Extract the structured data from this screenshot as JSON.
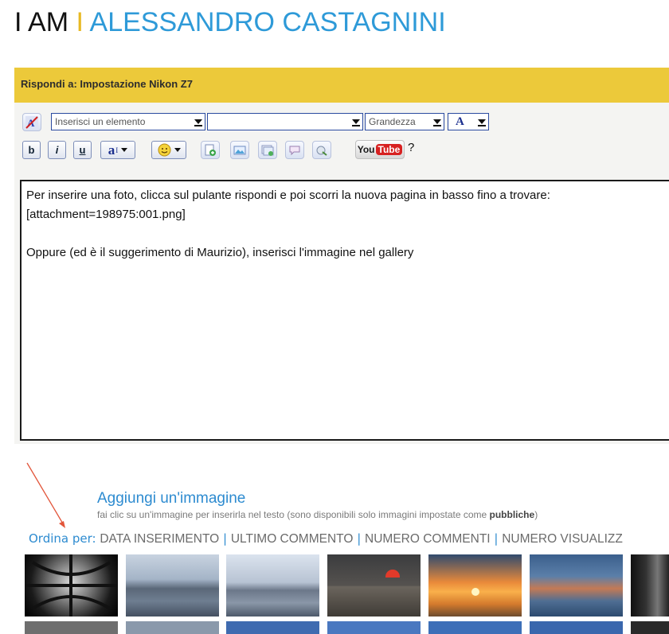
{
  "header": {
    "title_left": "I AM",
    "title_sep": "I",
    "title_right": "ALESSANDRO CASTAGNINI"
  },
  "reply": {
    "label": "Rispondi a: Impostazione Nikon Z7"
  },
  "toolbar": {
    "insert_element": "Inserisci un elemento",
    "second_select": "",
    "size_select": "Grandezza",
    "font_color_label": "A",
    "bold": "b",
    "italic": "i",
    "underline": "u",
    "font_style": "a",
    "youtube_you": "You",
    "youtube_tube": "Tube",
    "help": "?"
  },
  "editor": {
    "line1": "Per inserire una foto, clicca sul pulante rispondi e poi scorri la nuova pagina in basso fino a trovare:",
    "line2": "[attachment=198975:001.png]",
    "line3": "",
    "line4": "Oppure (ed è il suggerimento di Maurizio), inserisci l'immagine nel gallery"
  },
  "gallery": {
    "title": "Aggiungi un'immagine",
    "subtitle_pre": "fai clic su un'immagine per inserirla nel testo (sono disponibili solo immagini impostate come ",
    "subtitle_bold": "pubbliche",
    "subtitle_post": ")",
    "sort_label": "Ordina per:",
    "sort_options": [
      "DATA INSERIMENTO",
      "ULTIMO COMMENTO",
      "NUMERO COMMENTI",
      "NUMERO VISUALIZZ"
    ]
  },
  "colors": {
    "accent_blue": "#2e9ad8",
    "header_bar": "#ecc93a",
    "annotation_arrow": "#e2553a"
  }
}
